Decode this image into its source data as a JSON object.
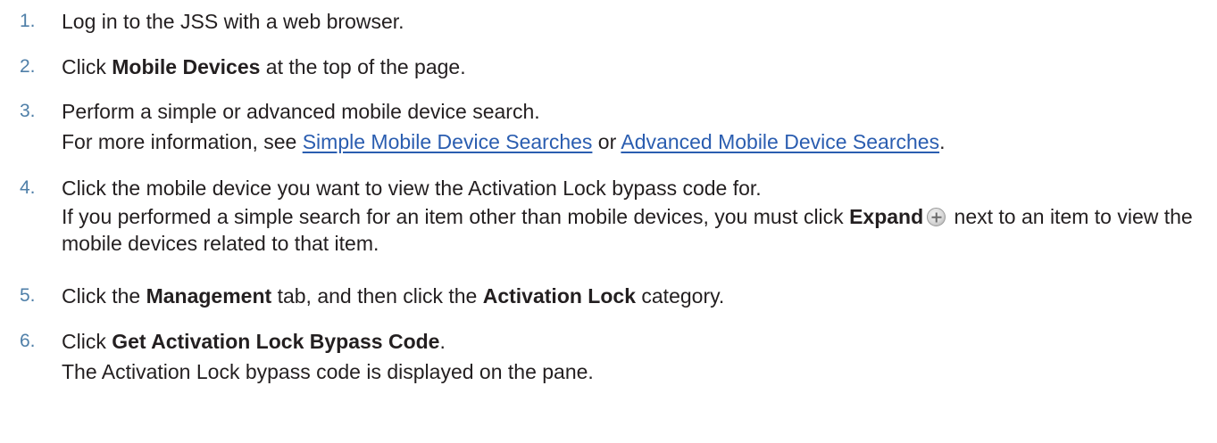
{
  "steps": [
    {
      "number": "1.",
      "text": "Log in to the JSS with a web browser."
    },
    {
      "number": "2.",
      "pre": "Click ",
      "bold": "Mobile Devices",
      "post": " at the top of the page."
    },
    {
      "number": "3.",
      "text": "Perform a simple or advanced mobile device search.",
      "sub": {
        "pre": "For more information, see ",
        "link1": "Simple Mobile Device Searches",
        "mid": " or ",
        "link2": "Advanced Mobile Device Searches",
        "post": "."
      }
    },
    {
      "number": "4.",
      "text": "Click the mobile device you want to view the Activation Lock bypass code for.",
      "sub": {
        "pre": "If you performed a simple search for an item other than mobile devices, you must click ",
        "bold": "Expand",
        "icon": "plus-circle-icon",
        "post": " next to an item to view the mobile devices related to that item."
      }
    },
    {
      "number": "5.",
      "pre": "Click the ",
      "bold1": "Management",
      "mid": " tab, and then click the ",
      "bold2": "Activation Lock",
      "post": " category."
    },
    {
      "number": "6.",
      "pre": "Click ",
      "bold": "Get Activation Lock Bypass Code",
      "post": ".",
      "sub": {
        "text": "The Activation Lock bypass code is displayed on the pane."
      }
    }
  ],
  "colors": {
    "step_number": "#4f7fa8",
    "body_text": "#231f20",
    "link": "#2a5db0"
  }
}
